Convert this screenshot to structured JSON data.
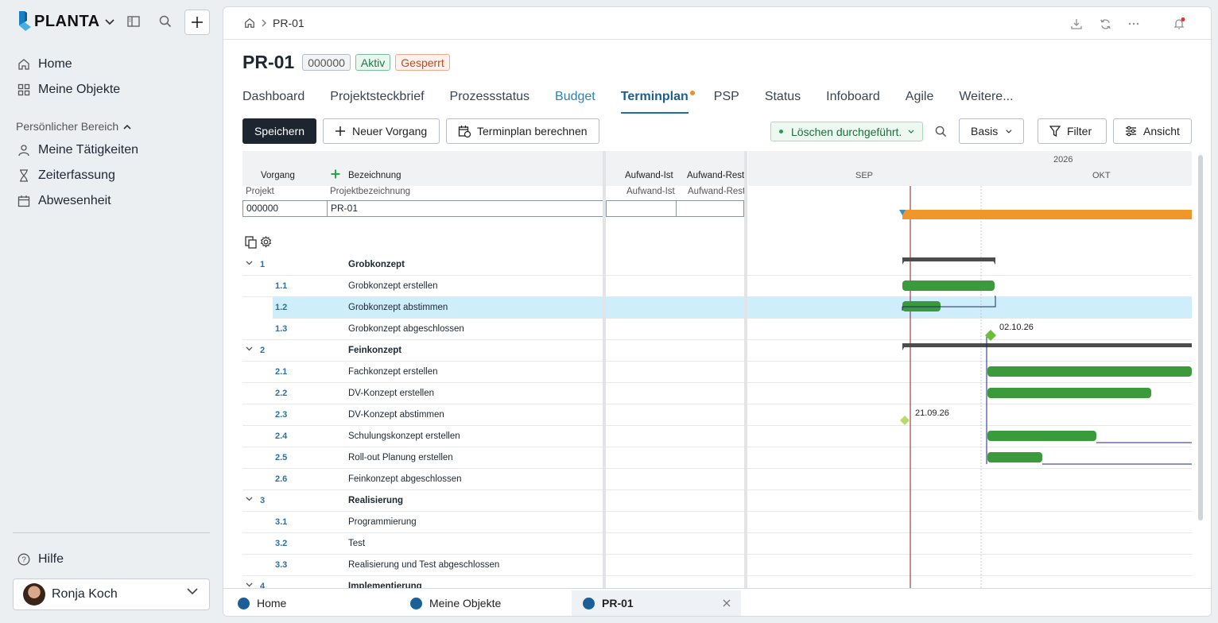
{
  "brand": {
    "name": "PLANTA"
  },
  "sidebar": {
    "items": [
      {
        "label": "Home"
      },
      {
        "label": "Meine Objekte"
      }
    ],
    "section_label": "Persönlicher Bereich",
    "personal": [
      {
        "label": "Meine Tätigkeiten"
      },
      {
        "label": "Zeiterfassung"
      },
      {
        "label": "Abwesenheit"
      }
    ],
    "help": "Hilfe",
    "user": "Ronja Koch"
  },
  "breadcrumb": {
    "current": "PR-01"
  },
  "project": {
    "title": "PR-01",
    "number": "000000",
    "status_active": "Aktiv",
    "status_locked": "Gesperrt"
  },
  "tabs": [
    {
      "label": "Dashboard"
    },
    {
      "label": "Projektsteckbrief"
    },
    {
      "label": "Prozessstatus"
    },
    {
      "label": "Budget"
    },
    {
      "label": "Terminplan"
    },
    {
      "label": "PSP"
    },
    {
      "label": "Status"
    },
    {
      "label": "Infoboard"
    },
    {
      "label": "Agile"
    },
    {
      "label": "Weitere..."
    }
  ],
  "toolbar": {
    "save": "Speichern",
    "new_task": "Neuer Vorgang",
    "calc": "Terminplan berechnen",
    "status": "Löschen durchgeführt.",
    "basis": "Basis",
    "filter": "Filter",
    "view": "Ansicht"
  },
  "grid": {
    "col_vorgang": "Vorgang",
    "col_bezeichnung": "Bezeichnung",
    "col_aufwand_ist": "Aufwand-Ist",
    "col_aufwand_rest": "Aufwand-Rest",
    "sub_projekt": "Projekt",
    "sub_projektbez": "Projektbezeichnung",
    "sub_aufwand_ist": "Aufwand-Ist",
    "sub_aufwand_rest": "Aufwand-Rest",
    "project_number": "000000",
    "project_name": "PR-01",
    "year": "2026",
    "month1": "SEP",
    "month2": "OKT",
    "rows": [
      {
        "code": "1",
        "name": "Grobkonzept",
        "group": true
      },
      {
        "code": "1.1",
        "name": "Grobkonzept erstellen"
      },
      {
        "code": "1.2",
        "name": "Grobkonzept abstimmen",
        "selected": true
      },
      {
        "code": "1.3",
        "name": "Grobkonzept abgeschlossen"
      },
      {
        "code": "2",
        "name": "Feinkonzept",
        "group": true
      },
      {
        "code": "2.1",
        "name": "Fachkonzept erstellen"
      },
      {
        "code": "2.2",
        "name": "DV-Konzept erstellen"
      },
      {
        "code": "2.3",
        "name": "DV-Konzept abstimmen"
      },
      {
        "code": "2.4",
        "name": "Schulungskonzept erstellen"
      },
      {
        "code": "2.5",
        "name": "Roll-out Planung erstellen"
      },
      {
        "code": "2.6",
        "name": "Feinkonzept abgeschlossen"
      },
      {
        "code": "3",
        "name": "Realisierung",
        "group": true
      },
      {
        "code": "3.1",
        "name": "Programmierung"
      },
      {
        "code": "3.2",
        "name": "Test"
      },
      {
        "code": "3.3",
        "name": "Realisierung und Test abgeschlossen"
      },
      {
        "code": "4",
        "name": "Implementierung",
        "group": true
      }
    ],
    "milestone1": "02.10.26",
    "milestone2": "21.09.26"
  },
  "bottom_tabs": [
    {
      "label": "Home"
    },
    {
      "label": "Meine Objekte"
    },
    {
      "label": "PR-01"
    }
  ],
  "colors": {
    "bar_green": "#3a9a3c",
    "bar_orange": "#f0962a",
    "summary": "#4c4c4c",
    "milestone": "#6cbd3a",
    "milestone_light": "#b6dc6a",
    "today_line": "#8b1a1a",
    "selection": "#cdeefa"
  }
}
